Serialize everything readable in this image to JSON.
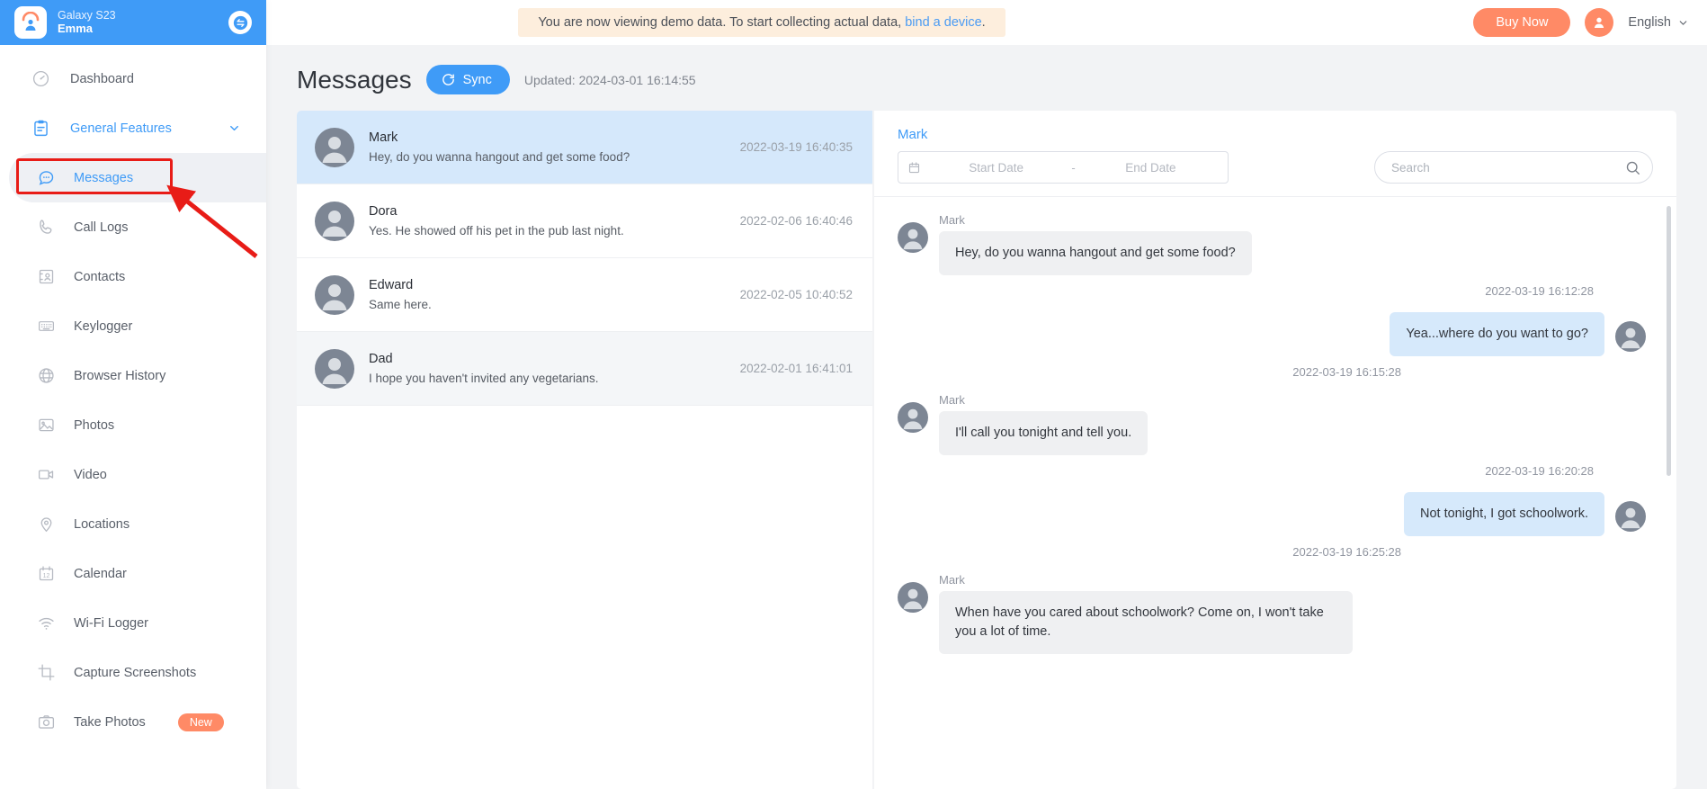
{
  "sidebar": {
    "device_model": "Galaxy S23",
    "device_user": "Emma",
    "logo_icon": "monitor-child-icon",
    "switch_icon": "switch-device-icon",
    "items": [
      {
        "label": "Dashboard",
        "icon": "dashboard-gauge-icon"
      },
      {
        "label": "General Features",
        "icon": "clipboard-icon",
        "chevron": "chevron-down-icon"
      },
      {
        "label": "Messages",
        "icon": "message-bubble-icon"
      },
      {
        "label": "Call Logs",
        "icon": "phone-icon"
      },
      {
        "label": "Contacts",
        "icon": "contact-card-icon"
      },
      {
        "label": "Keylogger",
        "icon": "keyboard-icon"
      },
      {
        "label": "Browser History",
        "icon": "globe-icon"
      },
      {
        "label": "Photos",
        "icon": "image-icon"
      },
      {
        "label": "Video",
        "icon": "video-camera-icon"
      },
      {
        "label": "Locations",
        "icon": "map-pin-icon"
      },
      {
        "label": "Calendar",
        "icon": "calendar-icon"
      },
      {
        "label": "Wi-Fi Logger",
        "icon": "wifi-icon"
      },
      {
        "label": "Capture Screenshots",
        "icon": "crop-icon"
      },
      {
        "label": "Take Photos",
        "icon": "camera-icon",
        "badge": "New"
      }
    ]
  },
  "topbar": {
    "banner_text_before": "You are now viewing demo data. To start collecting actual data, ",
    "banner_link": "bind a device",
    "banner_text_after": ".",
    "buy_label": "Buy Now",
    "avatar_icon": "user-avatar-icon",
    "language": "English",
    "language_chevron": "chevron-down-icon"
  },
  "page": {
    "title": "Messages",
    "sync_label": "Sync",
    "sync_icon": "refresh-icon",
    "updated": "Updated: 2024-03-01 16:14:55"
  },
  "conversations": [
    {
      "name": "Mark",
      "preview": "Hey, do you wanna hangout and get some food?",
      "time": "2022-03-19 16:40:35",
      "state": "selected"
    },
    {
      "name": "Dora",
      "preview": "Yes. He showed off his pet in the pub last night.",
      "time": "2022-02-06 16:40:46",
      "state": "normal"
    },
    {
      "name": "Edward",
      "preview": "Same here.",
      "time": "2022-02-05 10:40:52",
      "state": "normal"
    },
    {
      "name": "Dad",
      "preview": "I hope you haven't invited any vegetarians.",
      "time": "2022-02-01 16:41:01",
      "state": "hovered"
    }
  ],
  "chat": {
    "title": "Mark",
    "calendar_icon": "calendar-icon",
    "start_placeholder": "Start Date",
    "end_placeholder": "End Date",
    "range_separator": "-",
    "start_value": "",
    "end_value": "",
    "search_placeholder": "Search",
    "search_value": "",
    "search_icon": "search-icon",
    "messages": [
      {
        "dir": "in",
        "name": "Mark",
        "text": "Hey, do you wanna hangout and get some food?",
        "time": "2022-03-19 16:12:28"
      },
      {
        "dir": "out",
        "name": "",
        "text": "Yea...where do you want to go?",
        "time": "2022-03-19 16:15:28"
      },
      {
        "dir": "in",
        "name": "Mark",
        "text": "I'll call you tonight and tell you.",
        "time": "2022-03-19 16:20:28"
      },
      {
        "dir": "out",
        "name": "",
        "text": "Not tonight, I got schoolwork.",
        "time": "2022-03-19 16:25:28"
      },
      {
        "dir": "in",
        "name": "Mark",
        "text": "When have you cared about schoolwork? Come on, I won't take you a lot of time.",
        "time": ""
      }
    ]
  },
  "colors": {
    "brand_blue": "#3f9bf7",
    "accent_orange": "#ff8a66",
    "banner_bg": "#fdeedd",
    "selected_row": "#d5e8fb",
    "bubble_in": "#eff0f2",
    "bubble_out": "#d6e9fb",
    "annotation_red": "#e81c17"
  }
}
